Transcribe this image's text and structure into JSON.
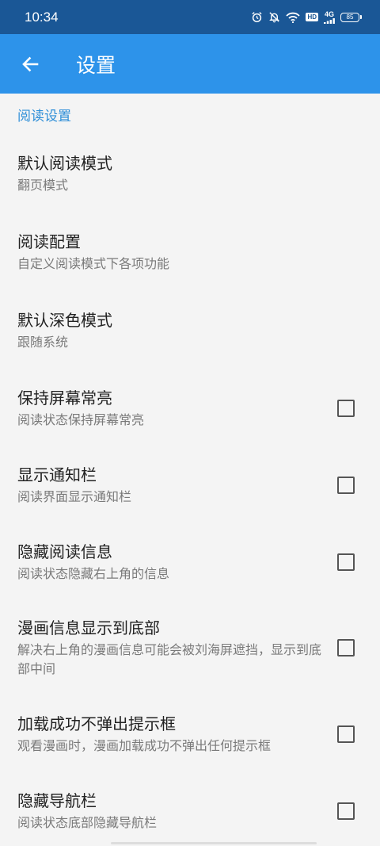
{
  "status_bar": {
    "time": "10:34",
    "network": "4G",
    "hd": "HD",
    "battery": "85"
  },
  "app_bar": {
    "title": "设置"
  },
  "section": {
    "title": "阅读设置"
  },
  "settings": [
    {
      "title": "默认阅读模式",
      "summary": "翻页模式",
      "has_checkbox": false
    },
    {
      "title": "阅读配置",
      "summary": "自定义阅读模式下各项功能",
      "has_checkbox": false
    },
    {
      "title": "默认深色模式",
      "summary": "跟随系统",
      "has_checkbox": false
    },
    {
      "title": "保持屏幕常亮",
      "summary": "阅读状态保持屏幕常亮",
      "has_checkbox": true,
      "checked": false
    },
    {
      "title": "显示通知栏",
      "summary": "阅读界面显示通知栏",
      "has_checkbox": true,
      "checked": false
    },
    {
      "title": "隐藏阅读信息",
      "summary": "阅读状态隐藏右上角的信息",
      "has_checkbox": true,
      "checked": false
    },
    {
      "title": "漫画信息显示到底部",
      "summary": "解决右上角的漫画信息可能会被刘海屏遮挡，显示到底部中间",
      "has_checkbox": true,
      "checked": false
    },
    {
      "title": "加载成功不弹出提示框",
      "summary": "观看漫画时，漫画加载成功不弹出任何提示框",
      "has_checkbox": true,
      "checked": false
    },
    {
      "title": "隐藏导航栏",
      "summary": "阅读状态底部隐藏导航栏",
      "has_checkbox": true,
      "checked": false
    }
  ],
  "colors": {
    "status_bar": "#1a5796",
    "app_bar": "#2d93ea",
    "section_header": "#2f8fd8",
    "background": "#f4f4f4"
  }
}
